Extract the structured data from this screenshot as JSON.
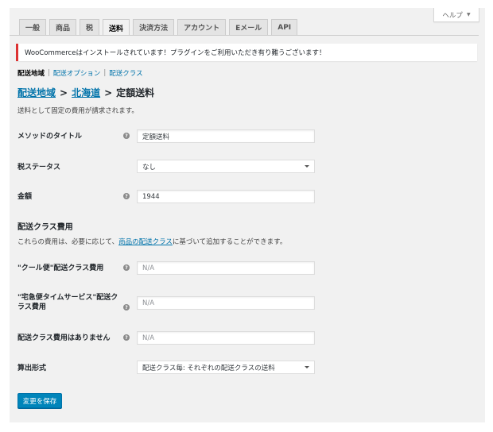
{
  "help_tab": {
    "label": "ヘルプ"
  },
  "tabs": [
    {
      "label": "一般"
    },
    {
      "label": "商品"
    },
    {
      "label": "税"
    },
    {
      "label": "送料"
    },
    {
      "label": "決済方法"
    },
    {
      "label": "アカウント"
    },
    {
      "label": "Eメール"
    },
    {
      "label": "API"
    }
  ],
  "notice": {
    "text": "WooCommerceはインストールされています！プラグインをご利用いただき有り難うございます！"
  },
  "subnav": {
    "current": "配送地域",
    "items": [
      "配送オプション",
      "配送クラス"
    ]
  },
  "breadcrumb": {
    "level1": "配送地域",
    "level2": "北海道",
    "current": "定額送料"
  },
  "description": "送料として固定の費用が請求されます。",
  "fields": {
    "method_title": {
      "label": "メソッドのタイトル",
      "value": "定額送料"
    },
    "tax_status": {
      "label": "税ステータス",
      "value": "なし"
    },
    "amount": {
      "label": "金額",
      "value": "1944"
    }
  },
  "class_costs": {
    "title": "配送クラス費用",
    "desc_prefix": "これらの費用は、必要に応じて、",
    "desc_link": "商品の配送クラス",
    "desc_suffix": "に基づいて追加することができます。",
    "cool": {
      "label": "\"クール便\"配送クラス費用",
      "placeholder": "N/A"
    },
    "takkyu": {
      "label_line1": "\"宅急便タイムサービス\"配送ク",
      "label_line2": "ラス費用",
      "placeholder": "N/A"
    },
    "no_class": {
      "label": "配送クラス費用はありません",
      "placeholder": "N/A"
    },
    "calc_type": {
      "label": "算出形式",
      "value": "配送クラス毎: それぞれの配送クラスの送料"
    }
  },
  "save_button": {
    "label": "変更を保存"
  }
}
